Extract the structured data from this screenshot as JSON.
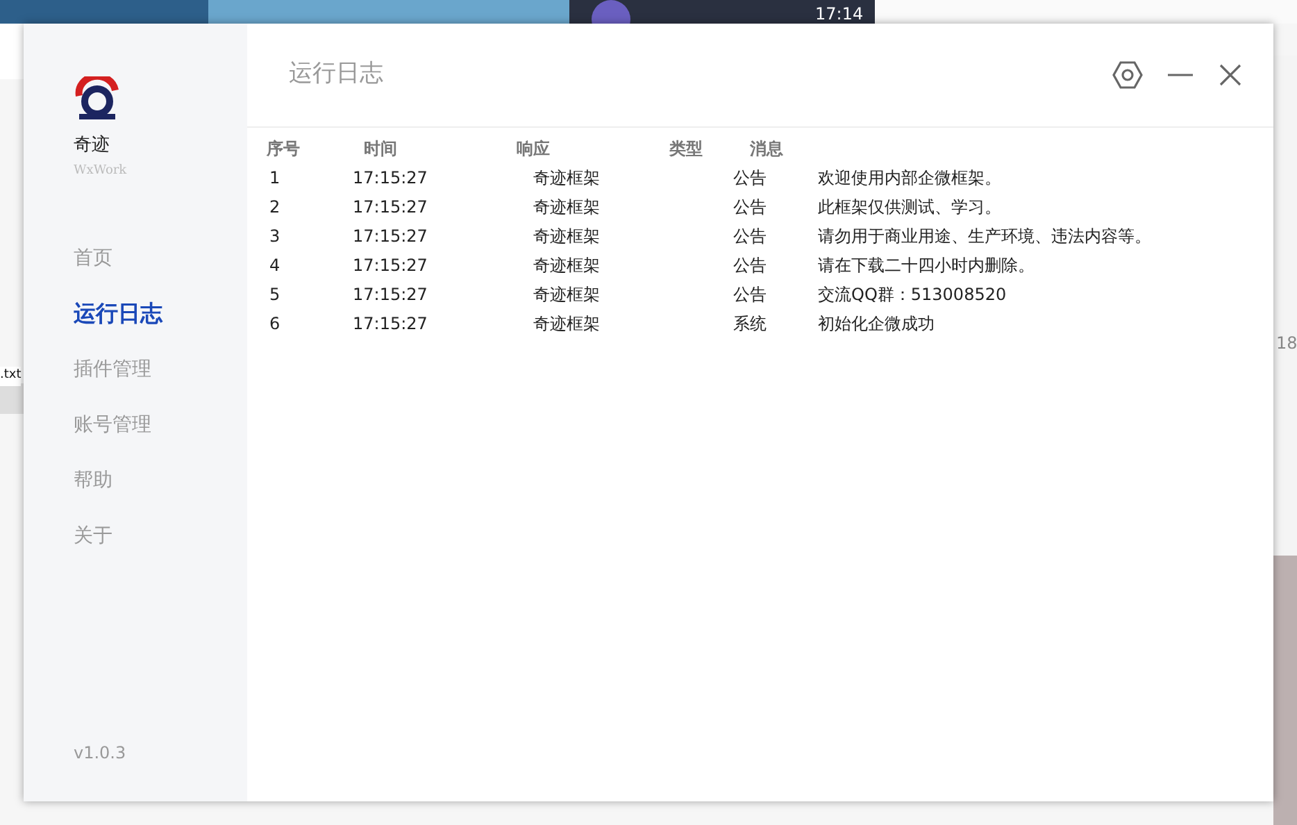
{
  "backdrop": {
    "kind": "picture",
    "fragments": [
      {
        "text": "17:14",
        "kind": "top"
      },
      {
        "text": ".txt",
        "kind": "left"
      },
      {
        "text": "18",
        "kind": "right"
      }
    ]
  },
  "sidebar": {
    "logo_title": "奇迹",
    "logo_subtitle": "WxWork",
    "items": [
      {
        "label": "首页",
        "selected": false
      },
      {
        "label": "运行日志",
        "selected": true
      },
      {
        "label": "插件管理",
        "selected": false
      },
      {
        "label": "账号管理",
        "selected": false
      },
      {
        "label": "帮助",
        "selected": false
      },
      {
        "label": "关于",
        "selected": false
      }
    ],
    "version": "v1.0.3"
  },
  "window": {
    "title": "运行日志"
  },
  "table": {
    "columns": [
      "序号",
      "时间",
      "响应",
      "类型",
      "消息"
    ],
    "rows": [
      [
        "1",
        "17:15:27",
        "奇迹框架",
        "公告",
        "欢迎使用内部企微框架。"
      ],
      [
        "2",
        "17:15:27",
        "奇迹框架",
        "公告",
        "此框架仅供测试、学习。"
      ],
      [
        "3",
        "17:15:27",
        "奇迹框架",
        "公告",
        "请勿用于商业用途、生产环境、违法内容等。"
      ],
      [
        "4",
        "17:15:27",
        "奇迹框架",
        "公告",
        "请在下载二十四小时内删除。"
      ],
      [
        "5",
        "17:15:27",
        "奇迹框架",
        "公告",
        "交流QQ群：513008520"
      ],
      [
        "6",
        "17:15:27",
        "奇迹框架",
        "系统",
        "初始化企微成功"
      ]
    ]
  }
}
